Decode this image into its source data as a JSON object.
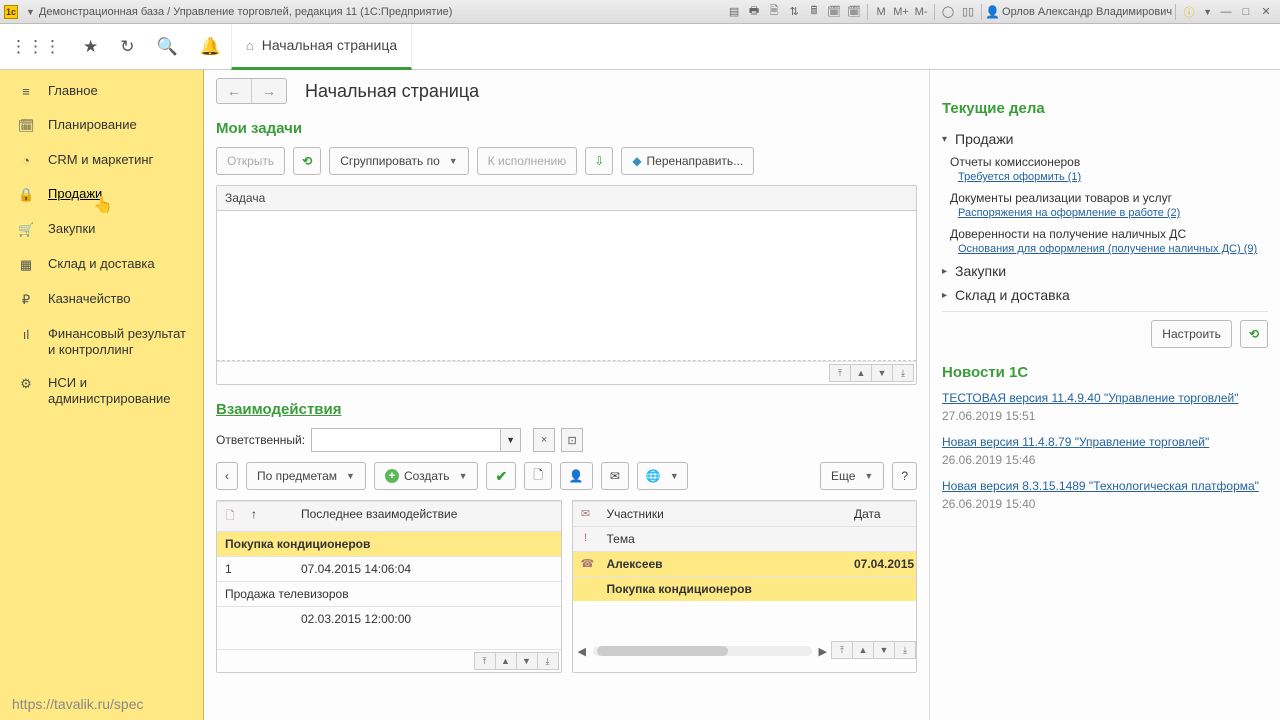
{
  "title": "Демонстрационная база / Управление торговлей, редакция 11 (1С:Предприятие)",
  "user": "Орлов Александр Владимирович",
  "tab_title": "Начальная страница",
  "page_heading": "Начальная страница",
  "sidebar": {
    "items": [
      {
        "icon": "≡",
        "label": "Главное"
      },
      {
        "icon": "🗓",
        "label": "Планирование"
      },
      {
        "icon": "◔",
        "label": "CRM и маркетинг"
      },
      {
        "icon": "🔒",
        "label": "Продажи"
      },
      {
        "icon": "🛒",
        "label": "Закупки"
      },
      {
        "icon": "▦",
        "label": "Склад и доставка"
      },
      {
        "icon": "₽",
        "label": "Казначейство"
      },
      {
        "icon": "ıl",
        "label": "Финансовый результат и контроллинг"
      },
      {
        "icon": "⚙",
        "label": "НСИ и администрирование"
      }
    ]
  },
  "footer_link": "https://tavalik.ru/spec",
  "tasks": {
    "title": "Мои задачи",
    "open": "Открыть",
    "group": "Сгруппировать по",
    "todo": "К исполнению",
    "forward": "Перенаправить...",
    "col_task": "Задача"
  },
  "interactions": {
    "title": "Взаимодействия",
    "responsible_label": "Ответственный:",
    "by_subject": "По предметам",
    "create": "Создать",
    "more": "Еще",
    "left_cols": {
      "c1": "",
      "c2": "↑",
      "c3": "Последнее взаимодействие"
    },
    "rows": [
      {
        "subject": "Покупка кондиционеров",
        "n": "1",
        "time": "07.04.2015 14:06:04",
        "sel": true
      },
      {
        "subject": "Продажа телевизоров",
        "n": "",
        "time": "02.03.2015 12:00:00",
        "sel": false
      }
    ],
    "right_cols": {
      "c1": "",
      "c2": "Участники",
      "c3": "Дата",
      "c4": "",
      "c5": "Тема"
    },
    "right_rows": [
      {
        "icon": "☎",
        "name": "Алексеев",
        "date": "07.04.2015",
        "subject": "Покупка кондиционеров"
      }
    ]
  },
  "current_affairs": {
    "title": "Текущие дела",
    "groups": [
      {
        "label": "Продажи",
        "open": true,
        "items": [
          {
            "title": "Отчеты комиссионеров",
            "link": "Требуется оформить (1)"
          },
          {
            "title": "Документы реализации товаров и услуг",
            "link": "Распоряжения на оформление в работе (2)"
          },
          {
            "title": "Доверенности на получение наличных ДС",
            "link": "Основания для оформления (получение наличных ДС) (9)"
          }
        ]
      },
      {
        "label": "Закупки",
        "open": false
      },
      {
        "label": "Склад и доставка",
        "open": false
      }
    ],
    "configure": "Настроить"
  },
  "news": {
    "title": "Новости 1С",
    "items": [
      {
        "link": "ТЕСТОВАЯ версия 11.4.9.40 \"Управление торговлей\"",
        "time": "27.06.2019 15:51"
      },
      {
        "link": "Новая версия 11.4.8.79 \"Управление торговлей\"",
        "time": "26.06.2019 15:46"
      },
      {
        "link": "Новая версия 8.3.15.1489 \"Технологическая платформа\"",
        "time": "26.06.2019 15:40"
      }
    ]
  }
}
